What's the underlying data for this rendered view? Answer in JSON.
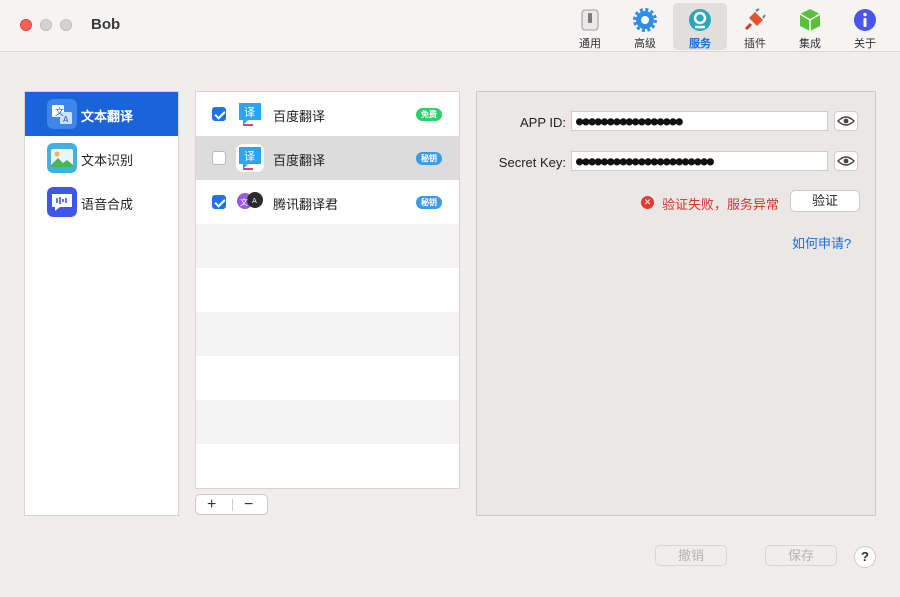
{
  "app": {
    "title": "Bob"
  },
  "toolbar": {
    "items": [
      {
        "label": "通用",
        "icon": "switch-icon"
      },
      {
        "label": "高级",
        "icon": "gear-icon"
      },
      {
        "label": "服务",
        "icon": "service-icon",
        "active": true
      },
      {
        "label": "插件",
        "icon": "plug-icon"
      },
      {
        "label": "集成",
        "icon": "cube-icon"
      },
      {
        "label": "关于",
        "icon": "info-icon"
      }
    ]
  },
  "sidebar": {
    "items": [
      {
        "label": "文本翻译",
        "icon": "translate-icon",
        "active": true
      },
      {
        "label": "文本识别",
        "icon": "image-recognition-icon"
      },
      {
        "label": "语音合成",
        "icon": "speech-icon"
      }
    ]
  },
  "services": {
    "rows": [
      {
        "name": "百度翻译",
        "checked": true,
        "badge": "免费",
        "badge_type": "free"
      },
      {
        "name": "百度翻译",
        "checked": false,
        "badge": "秘钥",
        "badge_type": "key",
        "selected": true
      },
      {
        "name": "腾讯翻译君",
        "checked": true,
        "badge": "秘钥",
        "badge_type": "key"
      }
    ],
    "add_label": "+",
    "remove_label": "−"
  },
  "config": {
    "app_id_label": "APP ID:",
    "app_id_value": "●●●●●●●●●●●●●●●●●",
    "secret_key_label": "Secret Key:",
    "secret_key_value": "●●●●●●●●●●●●●●●●●●●●●●",
    "error_text": "验证失败，服务异常",
    "verify_label": "验证",
    "how_to_apply": "如何申请?"
  },
  "footer": {
    "revert_label": "撤销",
    "save_label": "保存",
    "help_label": "?"
  },
  "colors": {
    "accent": "#1a64d9",
    "error": "#d93328",
    "badge_free": "#2ecf6b",
    "badge_key": "#3b9be8"
  }
}
